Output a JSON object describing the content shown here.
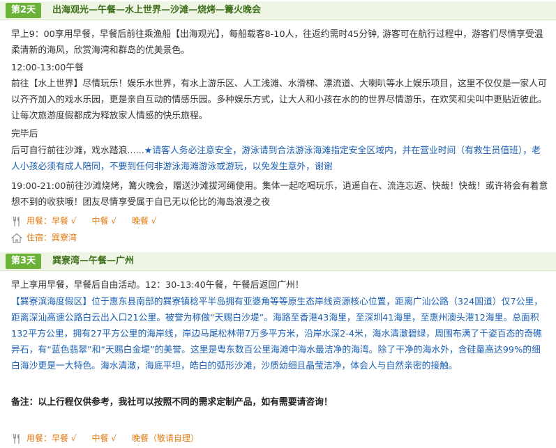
{
  "day2": {
    "badge": "第2天",
    "title": "出海观光—午餐—水上世界—沙滩—烧烤—篝火晚会",
    "p1": "早上9：00享用早餐，早餐后前往乘渔船【出海观光】，每船载客8-10人，往返约需时45分钟, 游客可在航行过程中，游客们尽情享受温柔清新的海风，欣赏海湾和群岛的优美景色。",
    "p2": "12:00-13:00午餐",
    "p3": "前往【水上世界】尽情玩乐！娱乐水世界，有水上游乐区、人工浅滩、水滑梯、漂流道、大喇叭等水上娱乐项目，这里不仅仅是一家人可以齐齐加入的戏水乐园，更是亲自互动的情感乐园。多种娱乐方式，让大人和小孩在水的的世界尽情游乐，在欢笑和尖叫中更贴近彼此。让每次旅游度假都成为释放家人情感的快乐旅程。",
    "p4": "完毕后",
    "p5a": "后可自行前往沙滩，戏水踏浪......",
    "p5b": "★请客人务必注意安全，游泳请到合法游泳海滩指定安全区域内，并在营业时间（有救生员值班），老人小孩必须有成人陪同，不要到任何非游泳海滩游泳或游玩，以免发生意外，谢谢",
    "p6": "19:00-21:00前往沙滩烧烤，篝火晚会，赠送沙滩拔河绳使用。集体一起吃喝玩乐，逍遥自在、流连忘返、快哉！快哉！或许将会有着意想不到的收获哦！团友尽情享受属于自已无以伦比的海岛浪漫之夜",
    "meal_label": "用餐：早餐 √",
    "meal_lunch": "中餐 √",
    "meal_dinner": "晚餐 √",
    "hotel": "住宿：巽寮湾"
  },
  "day3": {
    "badge": "第3天",
    "title": "巽寮湾—午餐—广州",
    "p1": "早上享用早餐，早餐后自由活动。12：30-13:40午餐，午餐后返回广州！",
    "p2": "【巽寮滨海度假区】位于惠东县南部的巽寮镇稔平半岛拥有亚婆角等等原生态岸线资源核心位置，距离广汕公路（324国道）仅7公里，距离深汕高速公路白云出入口21公里。被誉为称做“天赐白沙堤”。海路至香港43海里，至深圳41海里，至惠州澳头港12海里。总面积132平方公里，拥有27平方公里的海岸线，岸边马尾松林带7万多平方米，沿岸水深2-4米，海水清澈碧绿，周围布满了千姿百态的奇礁异石，有“蓝色翡翠”和“天赐白金堤”的美誉。这里是粤东数百公里海滩中海水最洁净的海湾。除了干净的海水外，含硅量高达99%的细白海沙更是一大特色。海水清澈，海底平坦，皓白的弧形沙滩，沙质幼细且晶莹洁净，体会人与自然亲密的接触。",
    "note": "备注：以上行程仅供参考，我社可以按照不同的需求定制产品，如有需要请咨询！",
    "meal_label": "用餐：早餐 √",
    "meal_lunch": "中餐 √",
    "meal_dinner": "晚餐（敬请自理）"
  }
}
